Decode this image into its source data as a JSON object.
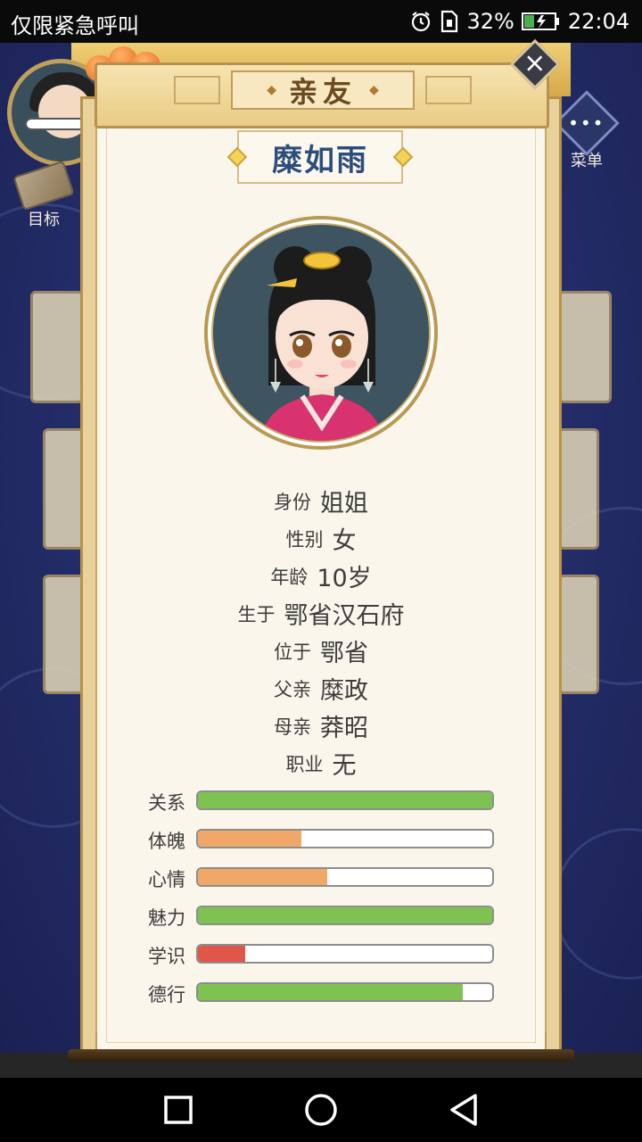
{
  "status_bar": {
    "carrier": "仅限紧急呼叫",
    "battery": "32%",
    "time": "22:04",
    "icons": [
      "alarm-icon",
      "sim-icon",
      "battery-charging-icon"
    ]
  },
  "background": {
    "goal_label": "目标",
    "menu_label": "菜单"
  },
  "dialog": {
    "title": "亲友",
    "name": "糜如雨",
    "info": [
      {
        "key": "身份",
        "value": "姐姐"
      },
      {
        "key": "性别",
        "value": "女"
      },
      {
        "key": "年龄",
        "value": "10岁"
      },
      {
        "key": "生于",
        "value": "鄂省汉石府"
      },
      {
        "key": "位于",
        "value": "鄂省"
      },
      {
        "key": "父亲",
        "value": "糜政"
      },
      {
        "key": "母亲",
        "value": "莽昭"
      },
      {
        "key": "职业",
        "value": "无"
      }
    ],
    "stats": [
      {
        "label": "关系",
        "level": 1.0,
        "color": "#7ec352"
      },
      {
        "label": "体魄",
        "level": 0.35,
        "color": "#f0a868"
      },
      {
        "label": "心情",
        "level": 0.44,
        "color": "#f0a868"
      },
      {
        "label": "魅力",
        "level": 1.0,
        "color": "#7ec352"
      },
      {
        "label": "学识",
        "level": 0.16,
        "color": "#e0574a"
      },
      {
        "label": "德行",
        "level": 0.9,
        "color": "#7ec352"
      }
    ]
  },
  "colors": {
    "good": "#7ec352",
    "medium": "#f0a868",
    "low": "#e0574a",
    "name_text": "#2d4d7c"
  }
}
